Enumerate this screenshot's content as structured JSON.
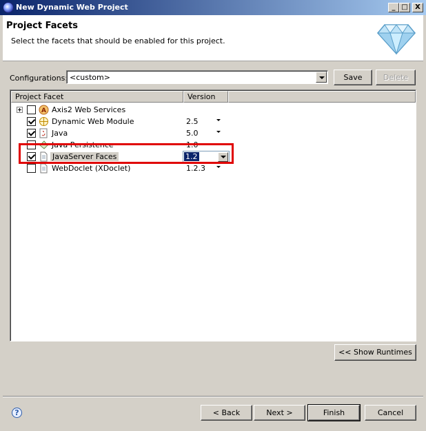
{
  "window": {
    "title": "New Dynamic Web Project",
    "controls": {
      "minimize": "_",
      "maximize": "□",
      "close": "X"
    }
  },
  "header": {
    "title": "Project Facets",
    "description": "Select the facets that should be enabled for this project."
  },
  "configurations": {
    "label": "Configurations:",
    "value": "<custom>",
    "save_label": "Save",
    "delete_label": "Delete"
  },
  "table": {
    "columns": [
      "Project Facet",
      "Version"
    ],
    "rows": [
      {
        "name": "Axis2 Web Services",
        "version": "",
        "checked": false,
        "expandable": true,
        "icon": "axis2-icon"
      },
      {
        "name": "Dynamic Web Module",
        "version": "2.5",
        "checked": true,
        "icon": "web-module-icon"
      },
      {
        "name": "Java",
        "version": "5.0",
        "checked": true,
        "icon": "java-icon"
      },
      {
        "name": "Java Persistence",
        "version": "1.0",
        "checked": false,
        "icon": "jpa-icon"
      },
      {
        "name": "JavaServer Faces",
        "version": "1.2",
        "checked": true,
        "selected": true,
        "icon": "document-icon"
      },
      {
        "name": "WebDoclet (XDoclet)",
        "version": "1.2.3",
        "checked": false,
        "icon": "document-icon"
      }
    ]
  },
  "buttons": {
    "show_runtimes": "<< Show Runtimes",
    "back": "< Back",
    "next": "Next >",
    "finish": "Finish",
    "cancel": "Cancel"
  },
  "colors": {
    "highlight": "#e00000",
    "titlebar_start": "#0a246a",
    "titlebar_end": "#a6caf0"
  }
}
